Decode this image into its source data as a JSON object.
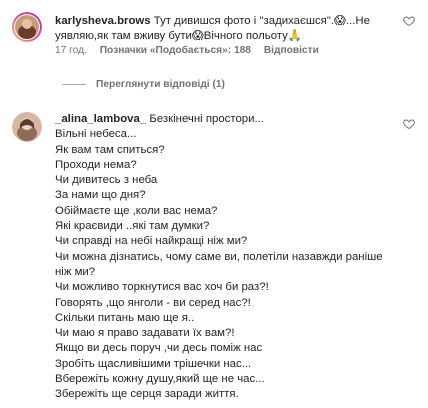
{
  "comment1": {
    "username": "karlysheva.brows",
    "text": "Тут дивишся фото і \"задихаєшся\".😱...Не уявляю,як там вживу бути😱Вічного польоту🙏",
    "time": "17 год.",
    "tagged_likes": "Позначки «Подобається»: 188",
    "reply": "Відповісти",
    "view_replies": "Переглянути відповіді (1)"
  },
  "comment2": {
    "username": "_alina_lambova_",
    "lines": [
      "Безкінечні простори...",
      "Вільні небеса...",
      "Як вам там спиться?",
      "Проходи нема?",
      "Чи дивитесь з неба",
      "За нами що дня?",
      "Обіймаєте ще ,коли вас нема?",
      "Які краєвиди ..які там думки?",
      "Чи справді на небі найкращі ніж ми?",
      "Чи можна дізнатись, чому саме ви, полетіли назавжди раніше ніж ми?",
      "Чи можливо торкнутися вас хоч би раз?!",
      "Говорять ,що янголи - ви серед нас?!",
      "Скільки питань маю ще я..",
      "Чи маю я право задавати їх вам?!",
      "Якщо ви десь поруч ,чи десь поміж нас",
      "Зробіть щасливішими трішечки нас...",
      "Вбережіть кожну душу,який ще не час...",
      "Збережіть ще серця заради життя."
    ]
  },
  "icons": {
    "like": "heart-outline-icon"
  },
  "colors": {
    "text": "#262626",
    "secondary": "#737373"
  }
}
